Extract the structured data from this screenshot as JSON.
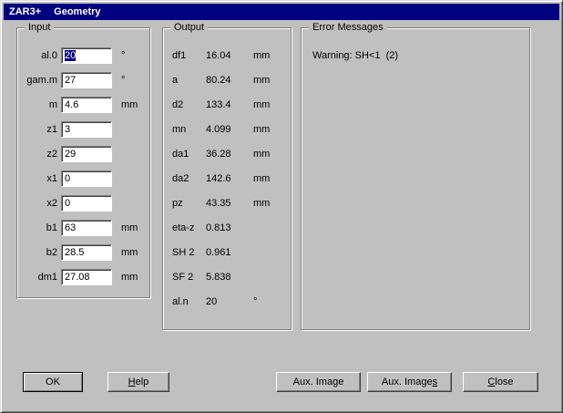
{
  "window": {
    "app_title": "ZAR3+",
    "doc_title": "Geometry"
  },
  "input_group": {
    "title": "Input",
    "rows": [
      {
        "label": "al.0",
        "value": "20",
        "unit": "°"
      },
      {
        "label": "gam.m",
        "value": "27",
        "unit": "°"
      },
      {
        "label": "m",
        "value": "4.6",
        "unit": "mm"
      },
      {
        "label": "z1",
        "value": "3",
        "unit": ""
      },
      {
        "label": "z2",
        "value": "29",
        "unit": ""
      },
      {
        "label": "x1",
        "value": "0",
        "unit": ""
      },
      {
        "label": "x2",
        "value": "0",
        "unit": ""
      },
      {
        "label": "b1",
        "value": "63",
        "unit": "mm"
      },
      {
        "label": "b2",
        "value": "28.5",
        "unit": "mm"
      },
      {
        "label": "dm1",
        "value": "27.08",
        "unit": "mm"
      }
    ]
  },
  "output_group": {
    "title": "Output",
    "rows": [
      {
        "name": "df1",
        "value": "16.04",
        "unit": "mm"
      },
      {
        "name": "a",
        "value": "80.24",
        "unit": "mm"
      },
      {
        "name": "d2",
        "value": "133.4",
        "unit": "mm"
      },
      {
        "name": "mn",
        "value": "4.099",
        "unit": "mm"
      },
      {
        "name": "da1",
        "value": "36.28",
        "unit": "mm"
      },
      {
        "name": "da2",
        "value": "142.6",
        "unit": "mm"
      },
      {
        "name": "pz",
        "value": "43.35",
        "unit": "mm"
      },
      {
        "name": "eta-z",
        "value": "0.813",
        "unit": ""
      },
      {
        "name": "SH 2",
        "value": "0.961",
        "unit": ""
      },
      {
        "name": "SF 2",
        "value": "5.838",
        "unit": ""
      },
      {
        "name": "al.n",
        "value": "20",
        "unit": "°"
      }
    ]
  },
  "error_group": {
    "title": "Error Messages",
    "message": "Warning: SH<1  (2)"
  },
  "buttons": {
    "ok": "OK",
    "help_accel": "H",
    "help_rest": "elp",
    "aux_image": "Aux. Image",
    "aux_images_pre": "Aux. Image",
    "aux_images_accel": "s",
    "close_accel": "C",
    "close_rest": "lose"
  }
}
